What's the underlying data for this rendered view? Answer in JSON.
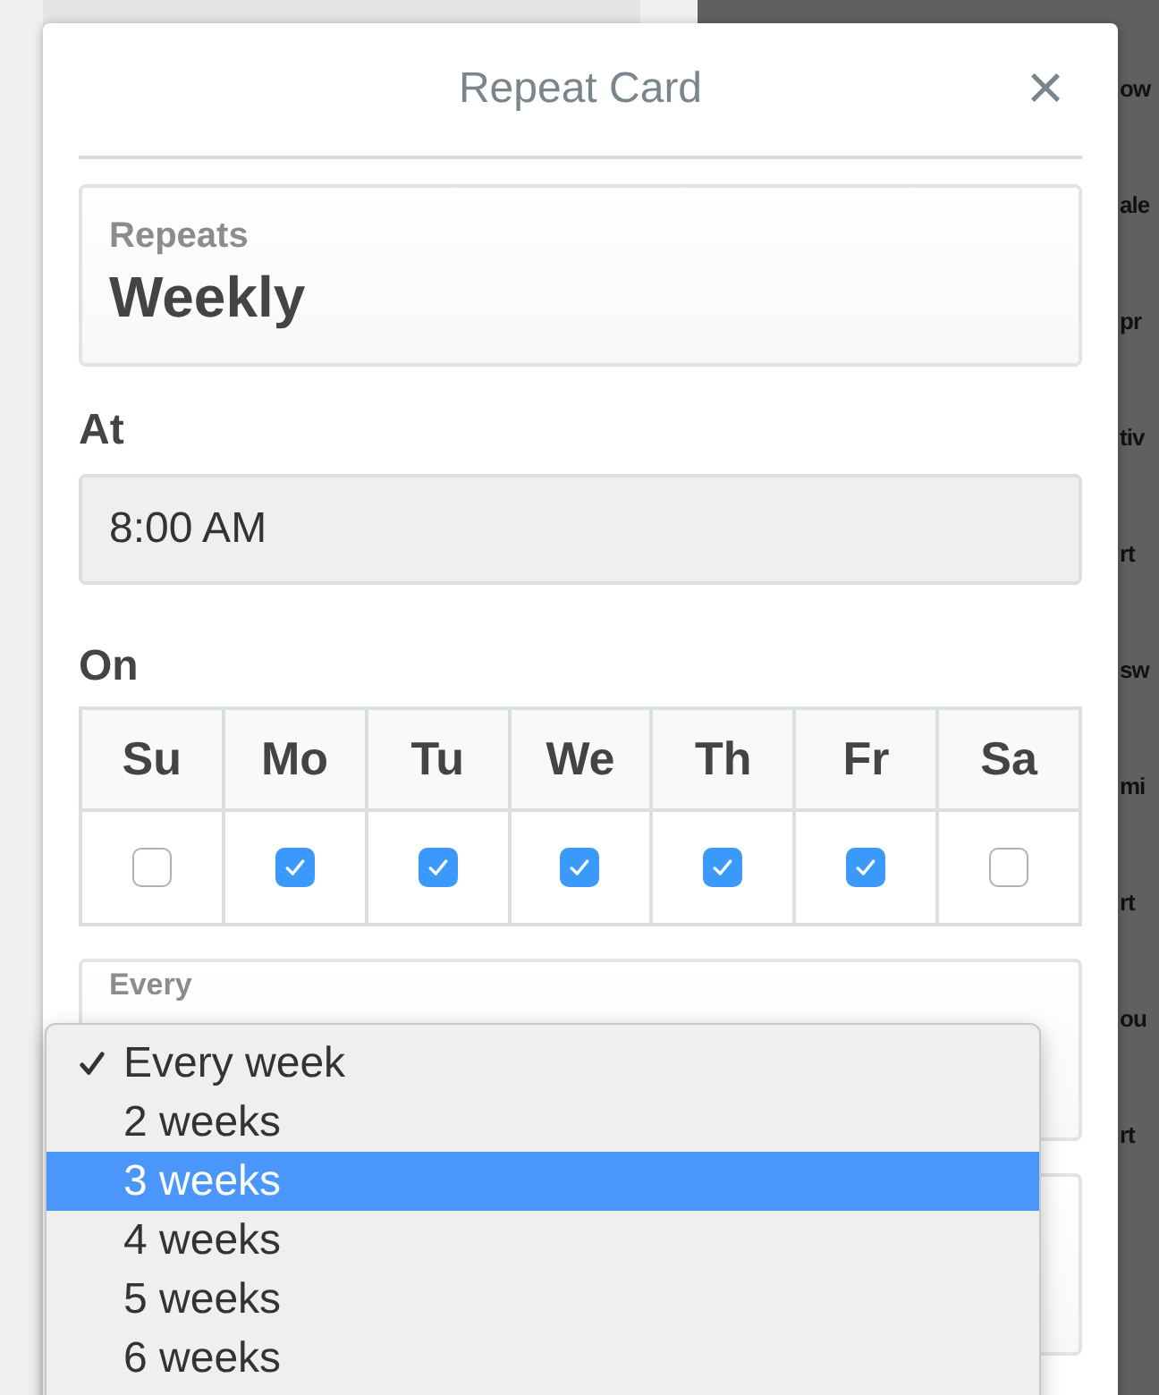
{
  "background_fragments": [
    "ow",
    "ale",
    "pr",
    "tiv",
    "rt",
    "sw",
    "mi",
    "rt",
    "ou",
    "rt"
  ],
  "modal": {
    "title": "Repeat Card",
    "close": "×",
    "repeats": {
      "label": "Repeats",
      "value": "Weekly"
    },
    "at": {
      "label": "At",
      "value": "8:00 AM"
    },
    "on": {
      "label": "On",
      "days": [
        {
          "label": "Su",
          "checked": false
        },
        {
          "label": "Mo",
          "checked": true
        },
        {
          "label": "Tu",
          "checked": true
        },
        {
          "label": "We",
          "checked": true
        },
        {
          "label": "Th",
          "checked": true
        },
        {
          "label": "Fr",
          "checked": true
        },
        {
          "label": "Sa",
          "checked": false
        }
      ]
    },
    "every": {
      "label": "Every"
    }
  },
  "dropdown": {
    "items": [
      {
        "label": "Every week",
        "checked": true,
        "selected": false
      },
      {
        "label": "2 weeks",
        "checked": false,
        "selected": false
      },
      {
        "label": "3 weeks",
        "checked": false,
        "selected": true
      },
      {
        "label": "4 weeks",
        "checked": false,
        "selected": false
      },
      {
        "label": "5 weeks",
        "checked": false,
        "selected": false
      },
      {
        "label": "6 weeks",
        "checked": false,
        "selected": false
      }
    ]
  }
}
